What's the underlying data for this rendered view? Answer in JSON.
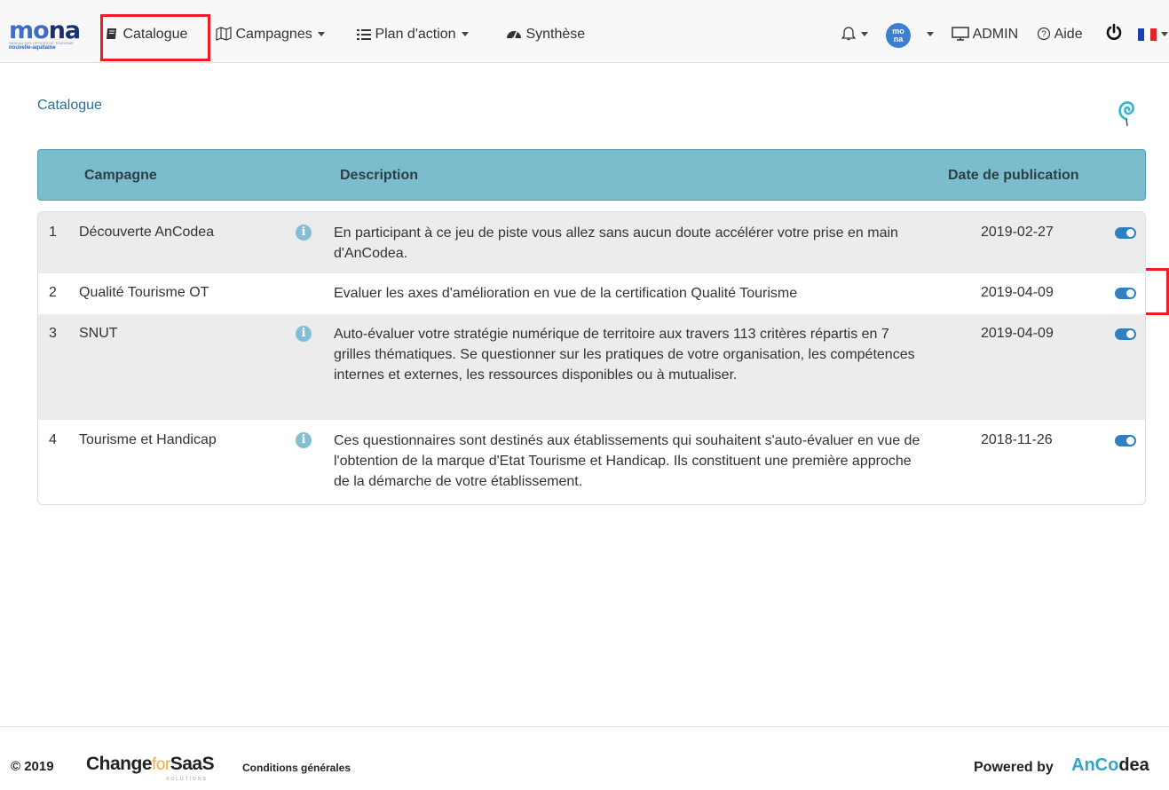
{
  "navbar": {
    "logo": {
      "text_mo": "mo",
      "text_na": "na",
      "tagline": "RESEAU DES OFFICES DE TOURISME",
      "region": "nouvelle-aquitaine"
    },
    "catalogue_label": "Catalogue",
    "campagnes_label": "Campagnes",
    "plan_label": "Plan d'action",
    "synthese_label": "Synthèse",
    "avatar_text": "mo\nna",
    "admin_label": "ADMIN",
    "aide_label": "Aide",
    "accent_color": "#3b7fd3",
    "highlight_color": "#ee1c24"
  },
  "page": {
    "breadcrumb": "Catalogue"
  },
  "table": {
    "headers": {
      "campagne": "Campagne",
      "description": "Description",
      "date": "Date de publication"
    },
    "header_color": "#7bbdcd",
    "rows": [
      {
        "num": "1",
        "name": "Découverte AnCodea",
        "has_info": true,
        "description": "En participant à ce jeu de piste vous allez sans aucun doute accélérer votre prise en main d'AnCodea.",
        "date": "2019-02-27",
        "enabled": true
      },
      {
        "num": "2",
        "name": "Qualité Tourisme OT",
        "has_info": false,
        "description": "Evaluer les axes d'amélioration en vue de la certification Qualité Tourisme",
        "date": "2019-04-09",
        "enabled": true
      },
      {
        "num": "3",
        "name": "SNUT",
        "has_info": true,
        "description": "Auto-évaluer votre stratégie numérique de territoire aux travers 113 critères répartis en 7 grilles thématiques. Se questionner sur les pratiques de votre organisation, les compétences internes et externes, les ressources disponibles ou à mutualiser.",
        "date": "2019-04-09",
        "enabled": true
      },
      {
        "num": "4",
        "name": "Tourisme et Handicap",
        "has_info": true,
        "description": "Ces questionnaires sont destinés aux établissements qui souhaitent s'auto-évaluer en vue de l'obtention de la marque d'Etat Tourisme et Handicap. Ils constituent une première approche de la démarche de votre établissement.",
        "date": "2018-11-26",
        "enabled": true
      }
    ]
  },
  "footer": {
    "copyright": "© 2019",
    "brand_change": "Change",
    "brand_for": "for",
    "brand_saas": "SaaS",
    "brand_solutions": "SOLUTIONS",
    "cgu_label": "Conditions générales",
    "powered_label": "Powered by",
    "ancodea_an": "AnC",
    "ancodea_o": "o",
    "ancodea_dea": "dea"
  }
}
